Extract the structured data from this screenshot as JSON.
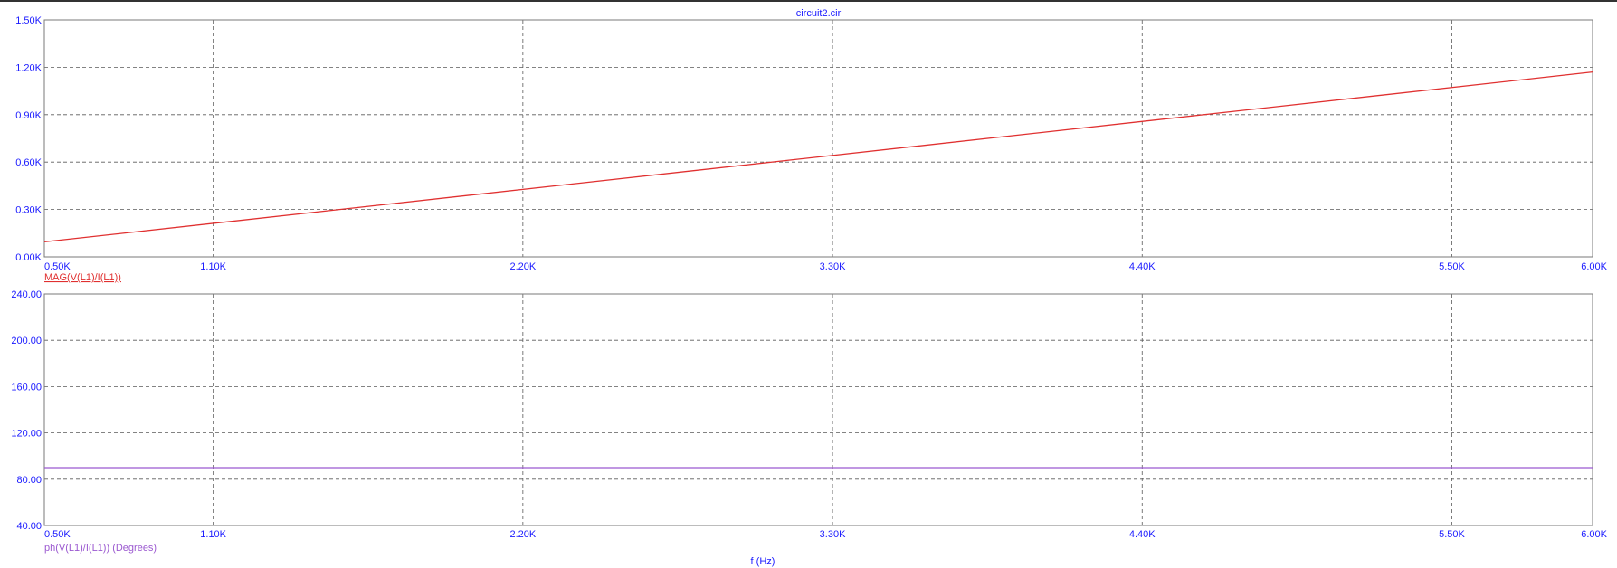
{
  "chart_data": [
    {
      "type": "line",
      "title": "circuit2.cir",
      "xlim": [
        500,
        6000
      ],
      "ylim": [
        0,
        1500
      ],
      "x_ticks": [
        "0.50K",
        "1.10K",
        "2.20K",
        "3.30K",
        "4.40K",
        "5.50K",
        "6.00K"
      ],
      "y_ticks": [
        "0.00K",
        "0.30K",
        "0.60K",
        "0.90K",
        "1.20K",
        "1.50K"
      ],
      "grid": true,
      "series": [
        {
          "name": "MAG(V(L1)/I(L1))",
          "color": "#e03030",
          "x": [
            500,
            6000
          ],
          "y": [
            95,
            1170
          ]
        }
      ]
    },
    {
      "type": "line",
      "xlim": [
        500,
        6000
      ],
      "ylim": [
        40,
        240
      ],
      "x_ticks": [
        "0.50K",
        "1.10K",
        "2.20K",
        "3.30K",
        "4.40K",
        "5.50K",
        "6.00K"
      ],
      "y_ticks": [
        "40.00",
        "80.00",
        "120.00",
        "160.00",
        "200.00",
        "240.00"
      ],
      "grid": true,
      "xlabel": "f (Hz)",
      "series": [
        {
          "name": "ph(V(L1)/I(L1)) (Degrees)",
          "color": "#9b59d0",
          "x": [
            500,
            6000
          ],
          "y": [
            90,
            90
          ]
        }
      ]
    }
  ],
  "colors": {
    "axis_text": "#1a1aff",
    "grid": "#5a5a5a"
  }
}
